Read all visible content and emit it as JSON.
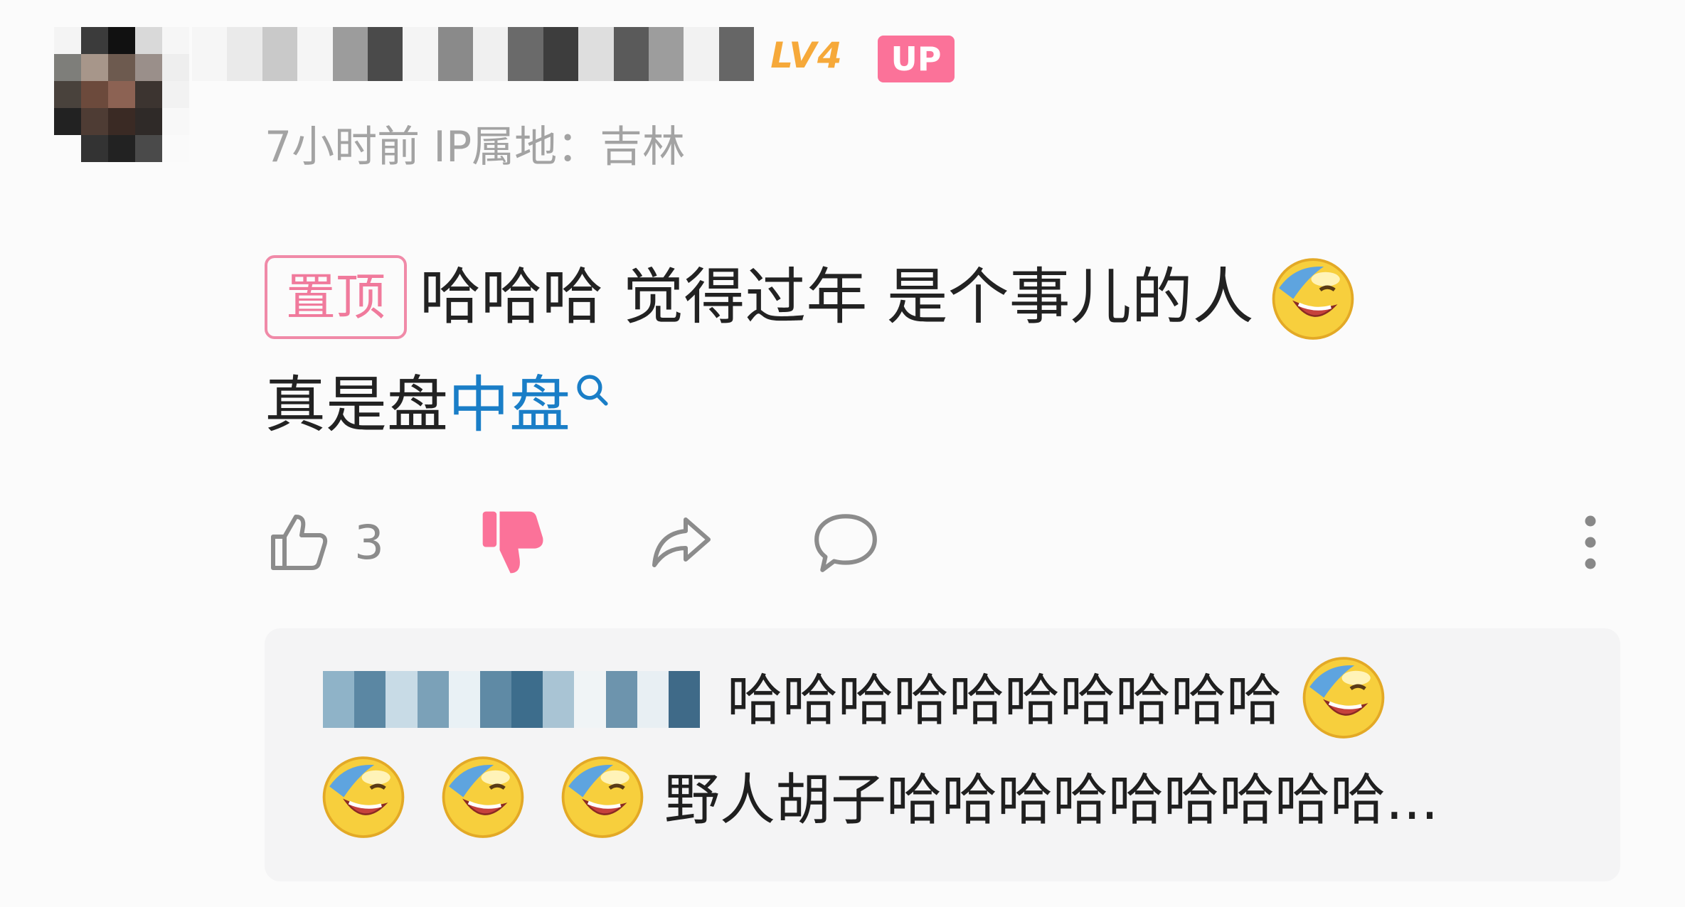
{
  "comment": {
    "level_badge": "LV4",
    "up_badge": "UP",
    "meta": "7小时前 IP属地：吉林",
    "pinned_badge": "置顶",
    "text_line1": "哈哈哈 觉得过年 是个事儿的人",
    "text_line2_plain": "真是盘",
    "text_line2_link": "中盘",
    "like_count": "3"
  },
  "reply": {
    "text_line1": "哈哈哈哈哈哈哈哈哈哈",
    "text_line2": "野人胡子哈哈哈哈哈哈哈哈哈..."
  },
  "icons": {
    "emoji": "laughing-crying-emoji",
    "search": "search-icon",
    "like": "thumbs-up-icon",
    "dislike": "thumbs-down-icon",
    "share": "share-icon",
    "comment": "speech-bubble-icon",
    "more": "more-vertical-icon"
  },
  "colors": {
    "accent_pink": "#fb7299",
    "level_orange": "#f6a93a",
    "link_blue": "#1a7ec7",
    "meta_gray": "#a3a3a3"
  }
}
